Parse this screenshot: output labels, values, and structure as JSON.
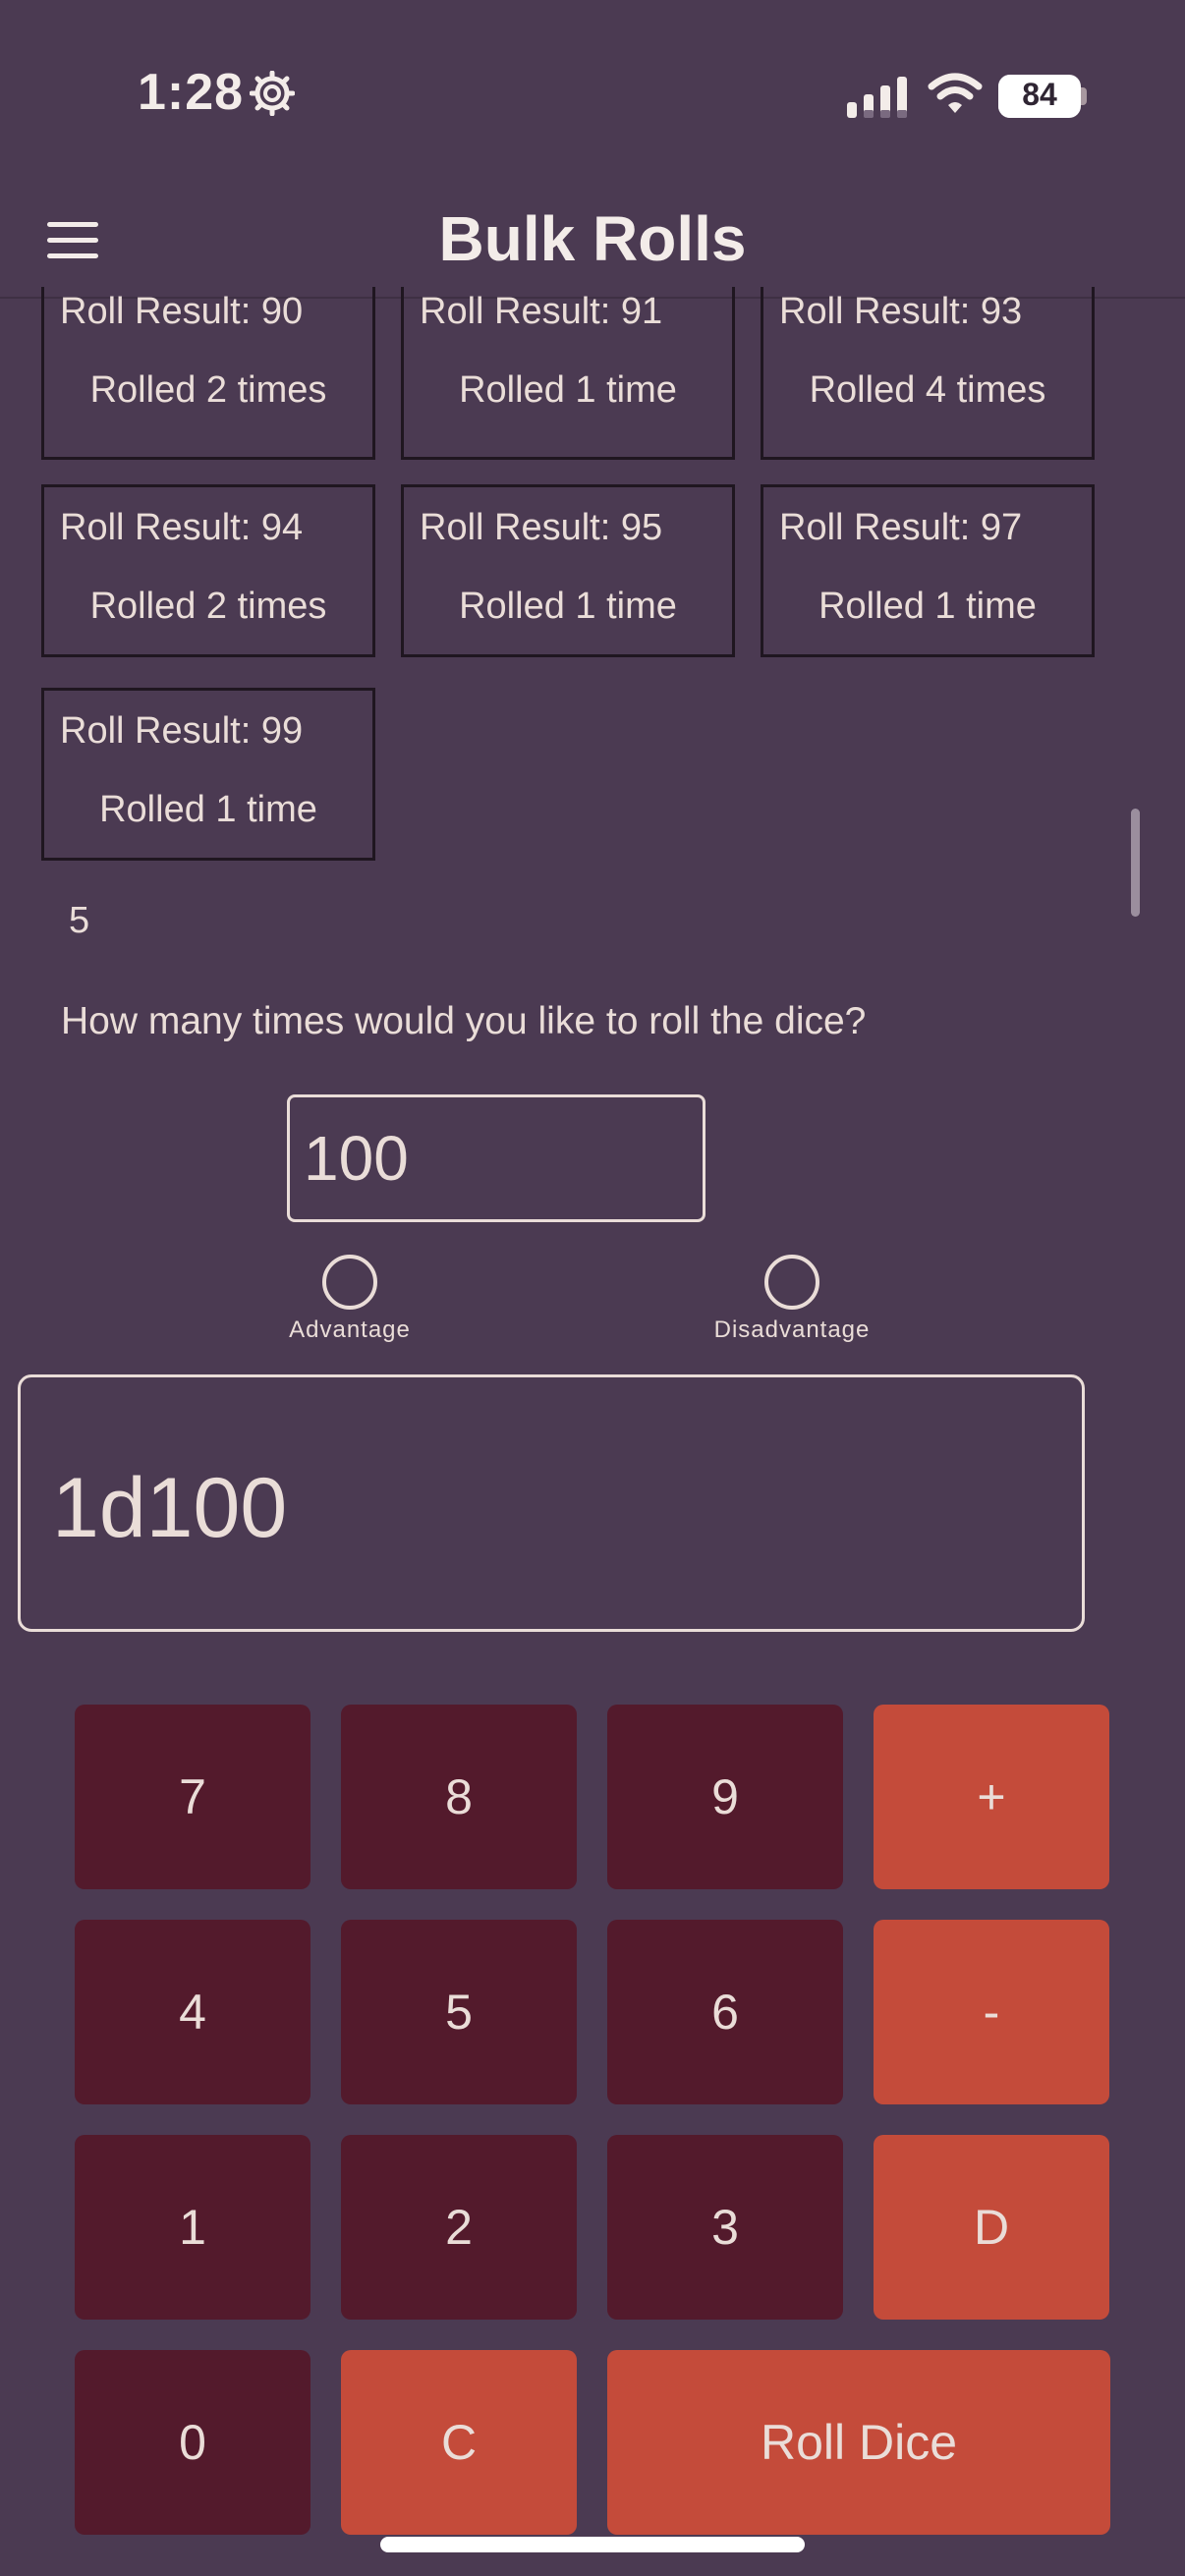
{
  "status": {
    "time": "1:28",
    "battery": "84"
  },
  "app_bar": {
    "title": "Bulk Rolls"
  },
  "results": [
    {
      "result": "Roll Result: 90",
      "count": "Rolled 2 times"
    },
    {
      "result": "Roll Result: 91",
      "count": "Rolled 1 time"
    },
    {
      "result": "Roll Result: 93",
      "count": "Rolled 4 times"
    },
    {
      "result": "Roll Result: 94",
      "count": "Rolled 2 times"
    },
    {
      "result": "Roll Result: 95",
      "count": "Rolled 1 time"
    },
    {
      "result": "Roll Result: 97",
      "count": "Rolled 1 time"
    },
    {
      "result": "Roll Result: 99",
      "count": "Rolled 1 time"
    }
  ],
  "summary": {
    "count": "5"
  },
  "roll_form": {
    "question": "How many times would you like to roll the dice?",
    "times_value": "100",
    "advantage_label": "Advantage",
    "disadvantage_label": "Disadvantage"
  },
  "expression": {
    "value": "1d100"
  },
  "keypad": {
    "k7": "7",
    "k8": "8",
    "k9": "9",
    "plus": "+",
    "k4": "4",
    "k5": "5",
    "k6": "6",
    "minus": "-",
    "k1": "1",
    "k2": "2",
    "k3": "3",
    "dice": "D",
    "k0": "0",
    "clear": "C",
    "roll": "Roll Dice"
  },
  "colors": {
    "background": "#4b3a52",
    "number_key": "#531a2c",
    "operator_key": "#c44b3a",
    "text": "#eaddd8"
  }
}
